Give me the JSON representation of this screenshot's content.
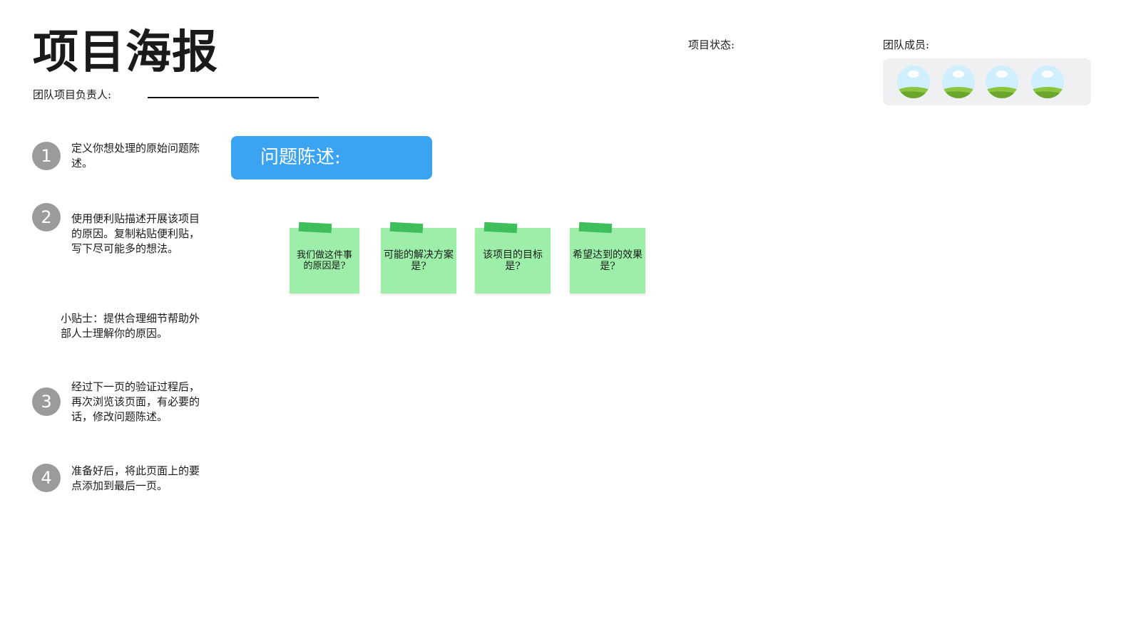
{
  "header": {
    "title": "项目海报",
    "lead_label": "团队项目负责人:",
    "status_label": "项目状态:",
    "members_label": "团队成员:"
  },
  "members": [
    {
      "avatar_icon": "landscape-avatar-icon"
    },
    {
      "avatar_icon": "landscape-avatar-icon"
    },
    {
      "avatar_icon": "landscape-avatar-icon"
    },
    {
      "avatar_icon": "landscape-avatar-icon"
    }
  ],
  "steps": [
    {
      "number": "1",
      "text": "定义你想处理的原始问题陈述。"
    },
    {
      "number": "2",
      "text": "使用便利贴描述开展该项目的原因。复制粘贴便利贴，写下尽可能多的想法。"
    },
    {
      "number": "3",
      "text": "经过下一页的验证过程后，再次浏览该页面，有必要的话，修改问题陈述。"
    },
    {
      "number": "4",
      "text": "准备好后，将此页面上的要点添加到最后一页。"
    }
  ],
  "tip": "小贴士：提供合理细节帮助外部人士理解你的原因。",
  "problem": {
    "label": "问题陈述:"
  },
  "notes": [
    {
      "text": "我们做这件事的原因是?"
    },
    {
      "text": "可能的解决方案是?"
    },
    {
      "text": "该项目的目标是?"
    },
    {
      "text": "希望达到的效果是?"
    }
  ],
  "colors": {
    "problem_box": "#3aa3f2",
    "sticky_note": "#9ceea8",
    "sticky_tape": "#3fbf5c",
    "step_circle": "#9b9b9b",
    "members_box": "#eef0f2"
  }
}
